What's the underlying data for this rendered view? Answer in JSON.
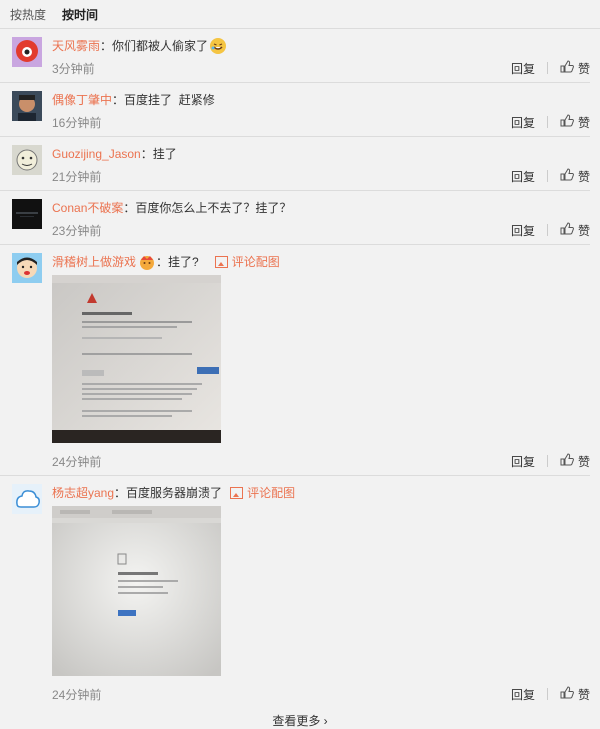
{
  "tabs": [
    {
      "label": "按热度",
      "active": false
    },
    {
      "label": "按时间",
      "active": true
    }
  ],
  "comments": [
    {
      "user": "天风雾雨",
      "text": "你们都被人偷家了",
      "time": "3分钟前",
      "reply": "回复",
      "like": "赞"
    },
    {
      "user": "偶像丁肇中",
      "text": "百度挂了  赶紧修",
      "time": "16分钟前",
      "reply": "回复",
      "like": "赞"
    },
    {
      "user": "Guozijing_Jason",
      "text": "挂了",
      "time": "21分钟前",
      "reply": "回复",
      "like": "赞"
    },
    {
      "user": "Conan不破案",
      "text": "百度你怎么上不去了？挂了？",
      "time": "23分钟前",
      "reply": "回复",
      "like": "赞"
    },
    {
      "user": "滑稽树上做游戏",
      "text": "挂了?",
      "pic_link": "评论配图",
      "time": "24分钟前",
      "reply": "回复",
      "like": "赞"
    },
    {
      "user": "杨志超yang",
      "text": "百度服务器崩溃了",
      "pic_link": "评论配图",
      "time": "24分钟前",
      "reply": "回复",
      "like": "赞"
    }
  ],
  "more": "查看更多 ›",
  "colors": {
    "username": "#eb7350",
    "background": "#f2f2f2"
  }
}
